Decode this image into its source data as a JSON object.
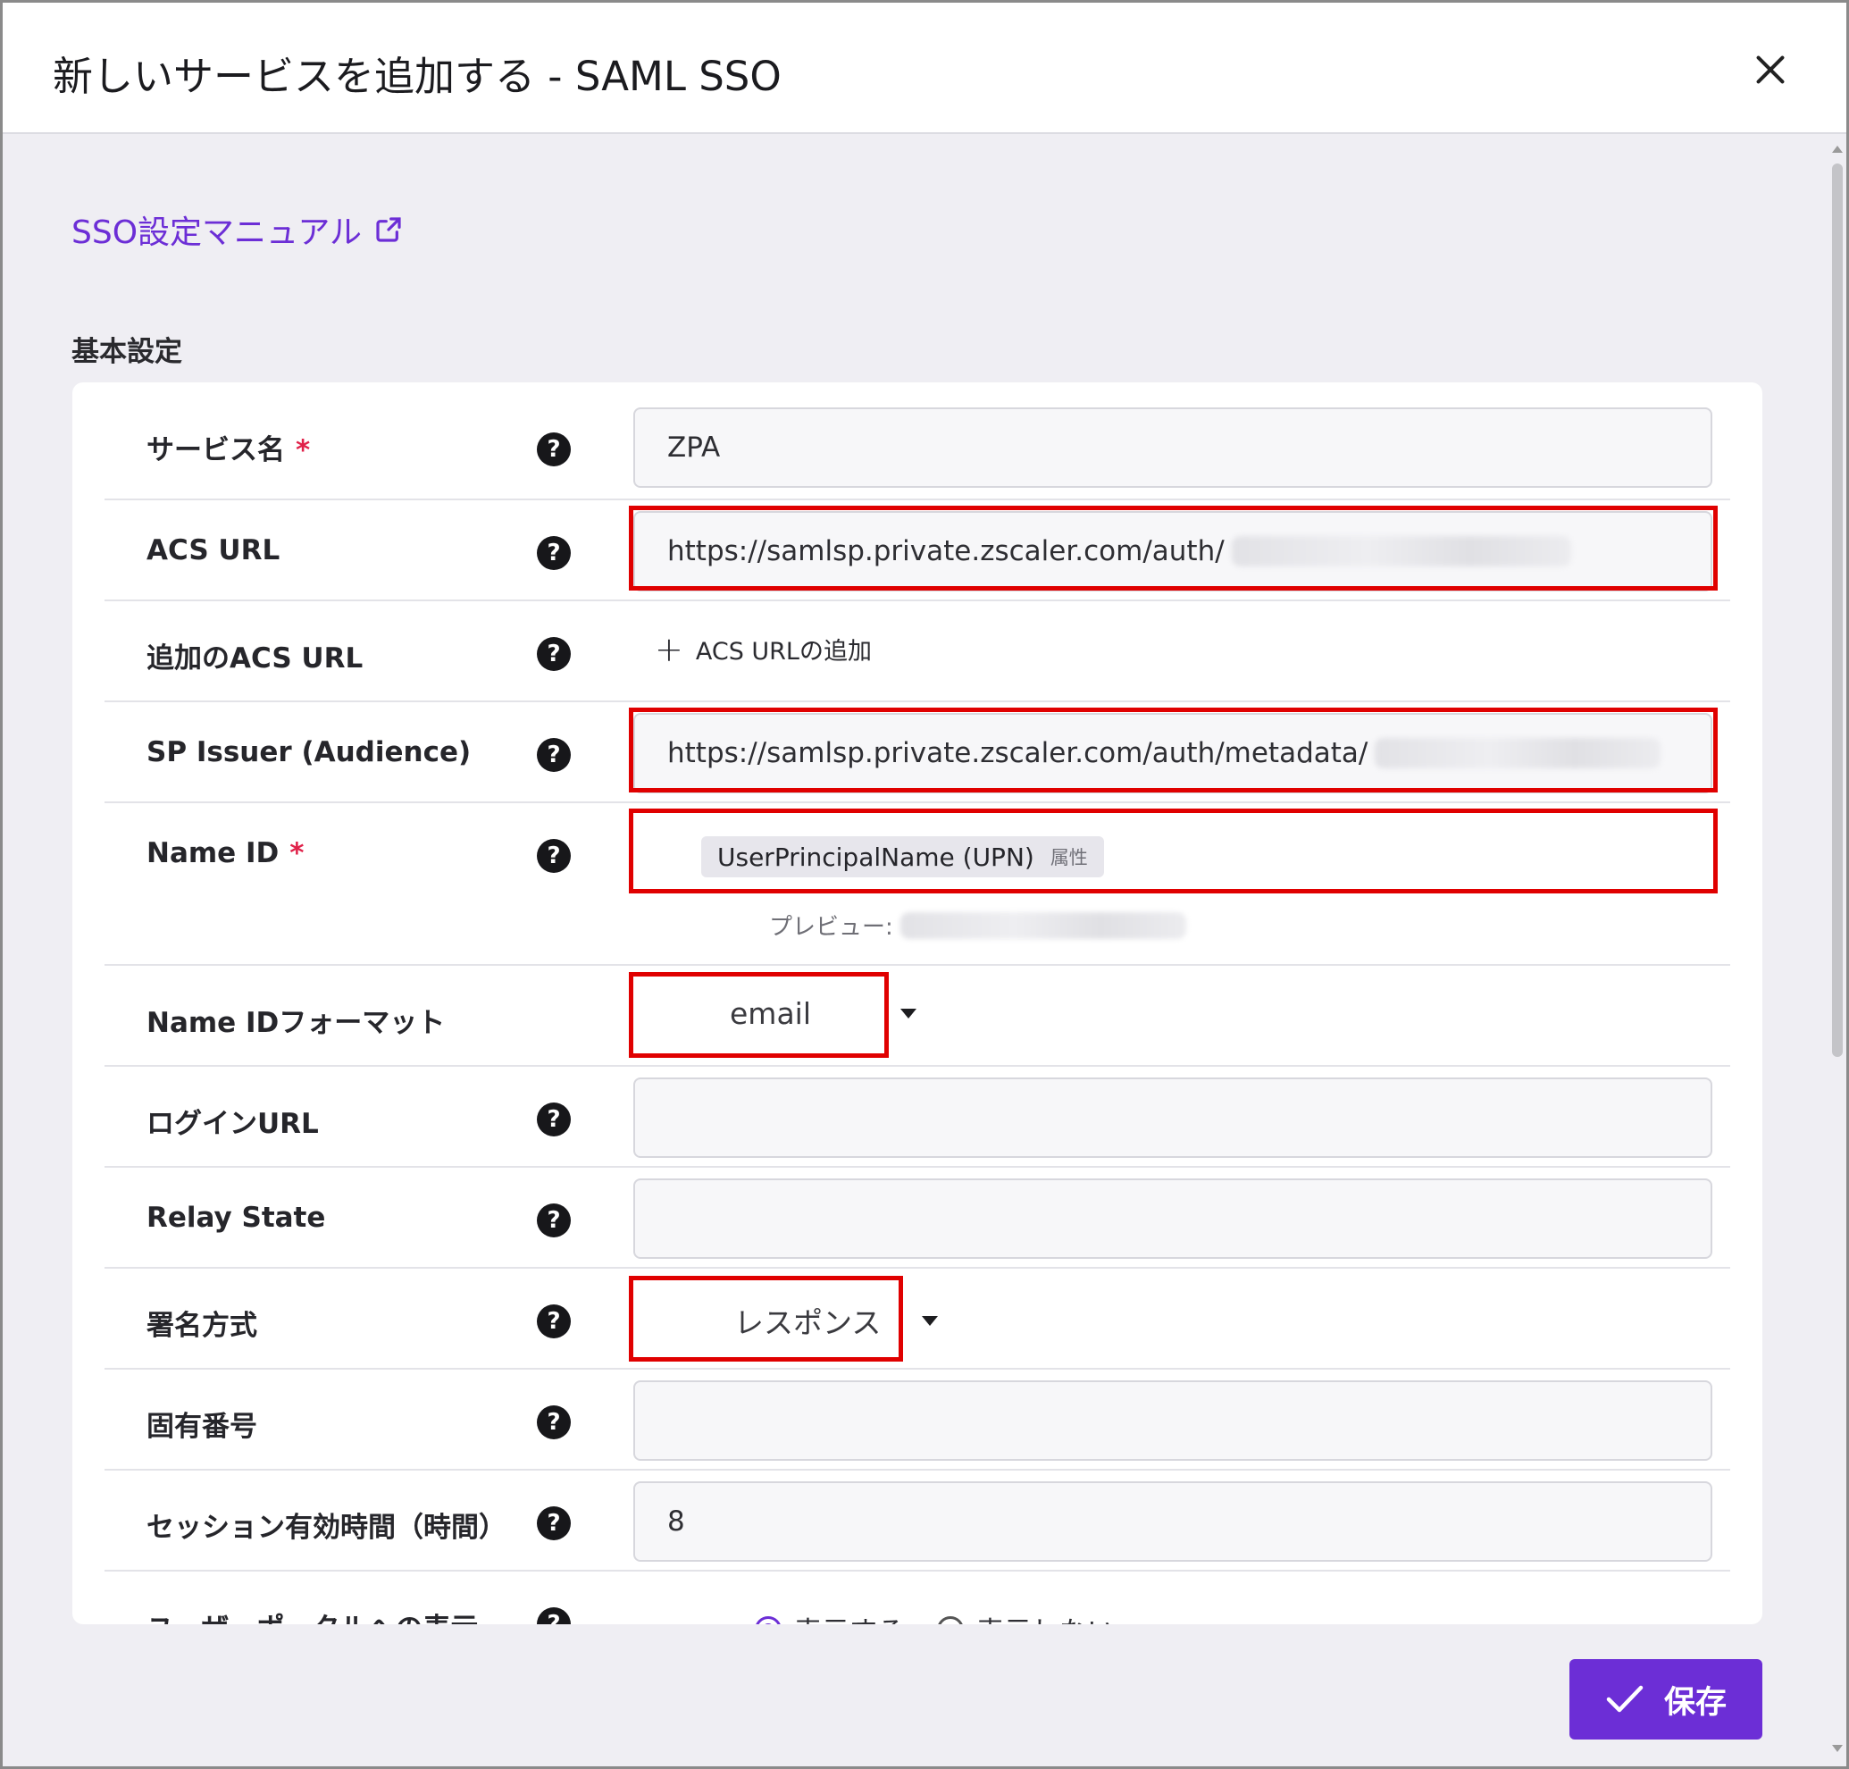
{
  "dialog": {
    "title": "新しいサービスを追加する - SAML SSO",
    "manual_link": "SSO設定マニュアル",
    "section_title": "基本設定",
    "save_label": "保存"
  },
  "fields": {
    "service_name": {
      "label": "サービス名",
      "required": "*",
      "value": "ZPA"
    },
    "acs_url": {
      "label": "ACS URL",
      "value": "https://samlsp.private.zscaler.com/auth/"
    },
    "additional_acs": {
      "label": "追加のACS URL",
      "add_label": "ACS URLの追加"
    },
    "sp_issuer": {
      "label": "SP Issuer (Audience)",
      "value": "https://samlsp.private.zscaler.com/auth/metadata/"
    },
    "name_id": {
      "label": "Name ID",
      "required": "*",
      "chip": "UserPrincipalName (UPN)",
      "chip_tag": "属性",
      "preview_label": "プレビュー:"
    },
    "name_id_format": {
      "label": "Name IDフォーマット",
      "value": "email"
    },
    "login_url": {
      "label": "ログインURL",
      "value": ""
    },
    "relay_state": {
      "label": "Relay State",
      "value": ""
    },
    "signature": {
      "label": "署名方式",
      "value": "レスポンス"
    },
    "unique_number": {
      "label": "固有番号",
      "value": ""
    },
    "session": {
      "label": "セッション有効時間（時間）",
      "value": "8"
    },
    "portal_display": {
      "label": "ユーザーポータルへの表示",
      "options": [
        "表示する",
        "表示しない"
      ],
      "selected": "表示する"
    }
  },
  "colors": {
    "accent": "#6c2ed6",
    "highlight": "#e00000",
    "required": "#e0224a"
  },
  "icons": {
    "help": "question-circle-icon",
    "close": "close-icon",
    "external": "external-link-icon",
    "check": "check-icon"
  }
}
